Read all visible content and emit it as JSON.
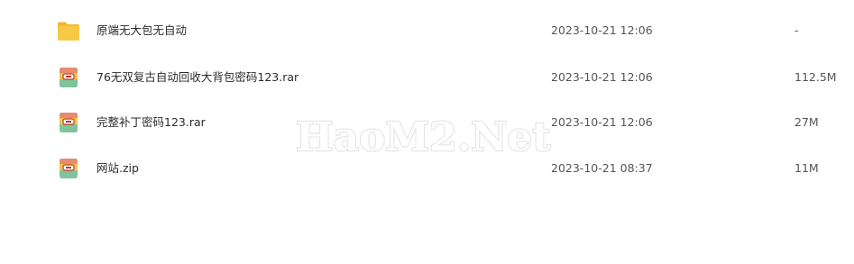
{
  "files": [
    {
      "icon": "folder-icon",
      "name": "原端无大包无自动",
      "date": "2023-10-21 12:06",
      "size": "-"
    },
    {
      "icon": "archive-icon",
      "name": "76无双复古自动回收大背包密码123.rar",
      "date": "2023-10-21 12:06",
      "size": "112.5M"
    },
    {
      "icon": "archive-icon",
      "name": "完整补丁密码123.rar",
      "date": "2023-10-21 12:06",
      "size": "27M"
    },
    {
      "icon": "archive-icon",
      "name": "网站.zip",
      "date": "2023-10-21 08:37",
      "size": "11M"
    }
  ],
  "watermark": {
    "text": "HaoM2.Net"
  },
  "colors": {
    "folder": "#f7c843",
    "archive_top": "#e98b6e",
    "archive_mid": "#f1c34b",
    "archive_bottom": "#7fc49a"
  }
}
